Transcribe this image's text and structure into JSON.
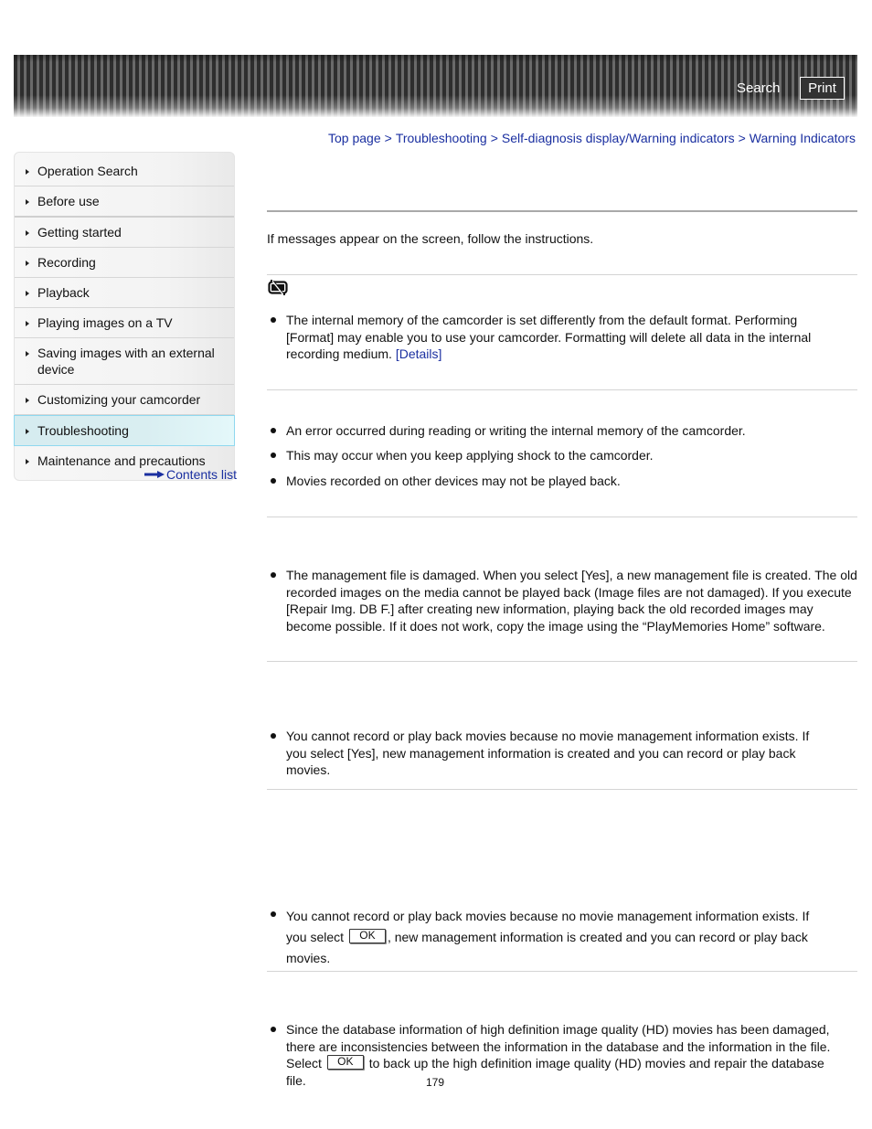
{
  "header": {
    "search_label": "Search",
    "print_label": "Print"
  },
  "breadcrumb": [
    {
      "label": "Top page"
    },
    {
      "label": "Troubleshooting"
    },
    {
      "label": "Self-diagnosis display/Warning indicators"
    },
    {
      "label": "Warning Indicators"
    }
  ],
  "breadcrumb_separator": ">",
  "sidebar": {
    "items": [
      {
        "label": "Operation Search"
      },
      {
        "label": "Before use"
      },
      {
        "label": "Getting started"
      },
      {
        "label": "Recording"
      },
      {
        "label": "Playback"
      },
      {
        "label": "Playing images on a TV"
      },
      {
        "label": "Saving images with an external device"
      },
      {
        "label": "Customizing your camcorder"
      },
      {
        "label": "Troubleshooting",
        "active": true
      },
      {
        "label": "Maintenance and precautions"
      }
    ],
    "contents_list_label": "Contents list"
  },
  "main": {
    "intro": "If messages appear on the screen, follow the instructions.",
    "sections": [
      {
        "icon": "internal-memory-format-error-icon",
        "bullets": [
          {
            "text": "The internal memory of the camcorder is set differently from the default format. Performing [Format] may enable you to use your camcorder. Formatting will delete all data in the internal recording medium.",
            "link": "[Details]"
          }
        ]
      },
      {
        "bullets": [
          {
            "text": "An error occurred during reading or writing the internal memory of the camcorder."
          },
          {
            "text": "This may occur when you keep applying shock to the camcorder."
          },
          {
            "text": "Movies recorded on other devices may not be played back."
          }
        ]
      },
      {
        "bullets": [
          {
            "text": "The management file is damaged. When you select [Yes], a new management file is created. The old recorded images on the media cannot be played back (Image files are not damaged). If you execute [Repair Img. DB F.] after creating new information, playing back the old recorded images may become possible. If it does not work, copy the image using the “PlayMemories Home” software."
          }
        ]
      },
      {
        "bullets": [
          {
            "text": "You cannot record or play back movies because no movie management information exists. If you select [Yes], new management information is created and you can record or play back movies."
          }
        ]
      },
      {
        "bullets": [
          {
            "text_before": "You cannot record or play back movies because no movie management information exists. If you select",
            "button": "OK",
            "text_after": ", new management information is created and you can record or play back movies."
          }
        ]
      },
      {
        "bullets": [
          {
            "text_before": "Since the database information of high definition image quality (HD) movies has been damaged, there are inconsistencies between the information in the database and the information in the file. Select",
            "button": "OK",
            "text_after": "to back up the high definition image quality (HD) movies and repair the database file."
          }
        ]
      }
    ]
  },
  "page_number": "179"
}
